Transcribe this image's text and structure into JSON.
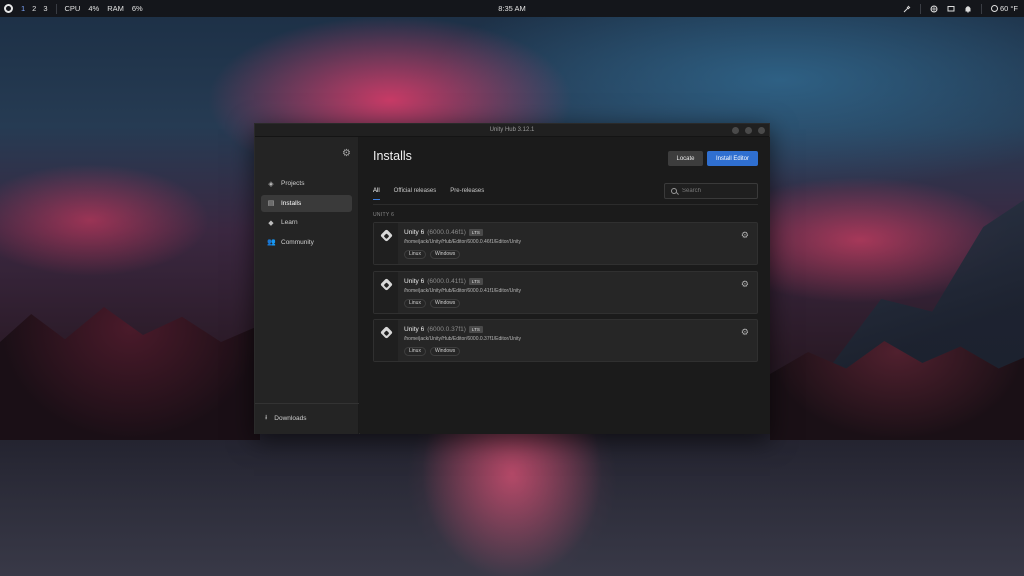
{
  "topbar": {
    "workspaces": [
      "1",
      "2",
      "3"
    ],
    "cpu_label": "CPU",
    "cpu_value": "4%",
    "ram_label": "RAM",
    "ram_value": "6%",
    "clock": "8:35 AM",
    "weather": "60 °F"
  },
  "window": {
    "title": "Unity Hub 3.12.1"
  },
  "sidebar": {
    "items": [
      {
        "label": "Projects",
        "icon": "cube-icon"
      },
      {
        "label": "Installs",
        "icon": "installs-icon"
      },
      {
        "label": "Learn",
        "icon": "graduation-cap-icon"
      },
      {
        "label": "Community",
        "icon": "users-icon"
      }
    ],
    "active_index": 1,
    "downloads_label": "Downloads"
  },
  "main": {
    "title": "Installs",
    "locate_label": "Locate",
    "install_editor_label": "Install Editor",
    "tabs": [
      {
        "label": "All"
      },
      {
        "label": "Official releases"
      },
      {
        "label": "Pre-releases"
      }
    ],
    "search_placeholder": "Search",
    "group_label": "UNITY 6",
    "installs": [
      {
        "name": "Unity 6",
        "version": "(6000.0.46f1)",
        "badge": "LTS",
        "path": "/home/jack/Unity/Hub/Editor/6000.0.46f1/Editor/Unity",
        "platforms": [
          "Linux",
          "Windows"
        ]
      },
      {
        "name": "Unity 6",
        "version": "(6000.0.41f1)",
        "badge": "LTS",
        "path": "/home/jack/Unity/Hub/Editor/6000.0.41f1/Editor/Unity",
        "platforms": [
          "Linux",
          "Windows"
        ]
      },
      {
        "name": "Unity 6",
        "version": "(6000.0.37f1)",
        "badge": "LTS",
        "path": "/home/jack/Unity/Hub/Editor/6000.0.37f1/Editor/Unity",
        "platforms": [
          "Linux",
          "Windows"
        ]
      }
    ]
  },
  "colors": {
    "accent": "#2f6fd0",
    "window_bg": "#1b1b1b",
    "sidebar_bg": "#242424"
  }
}
